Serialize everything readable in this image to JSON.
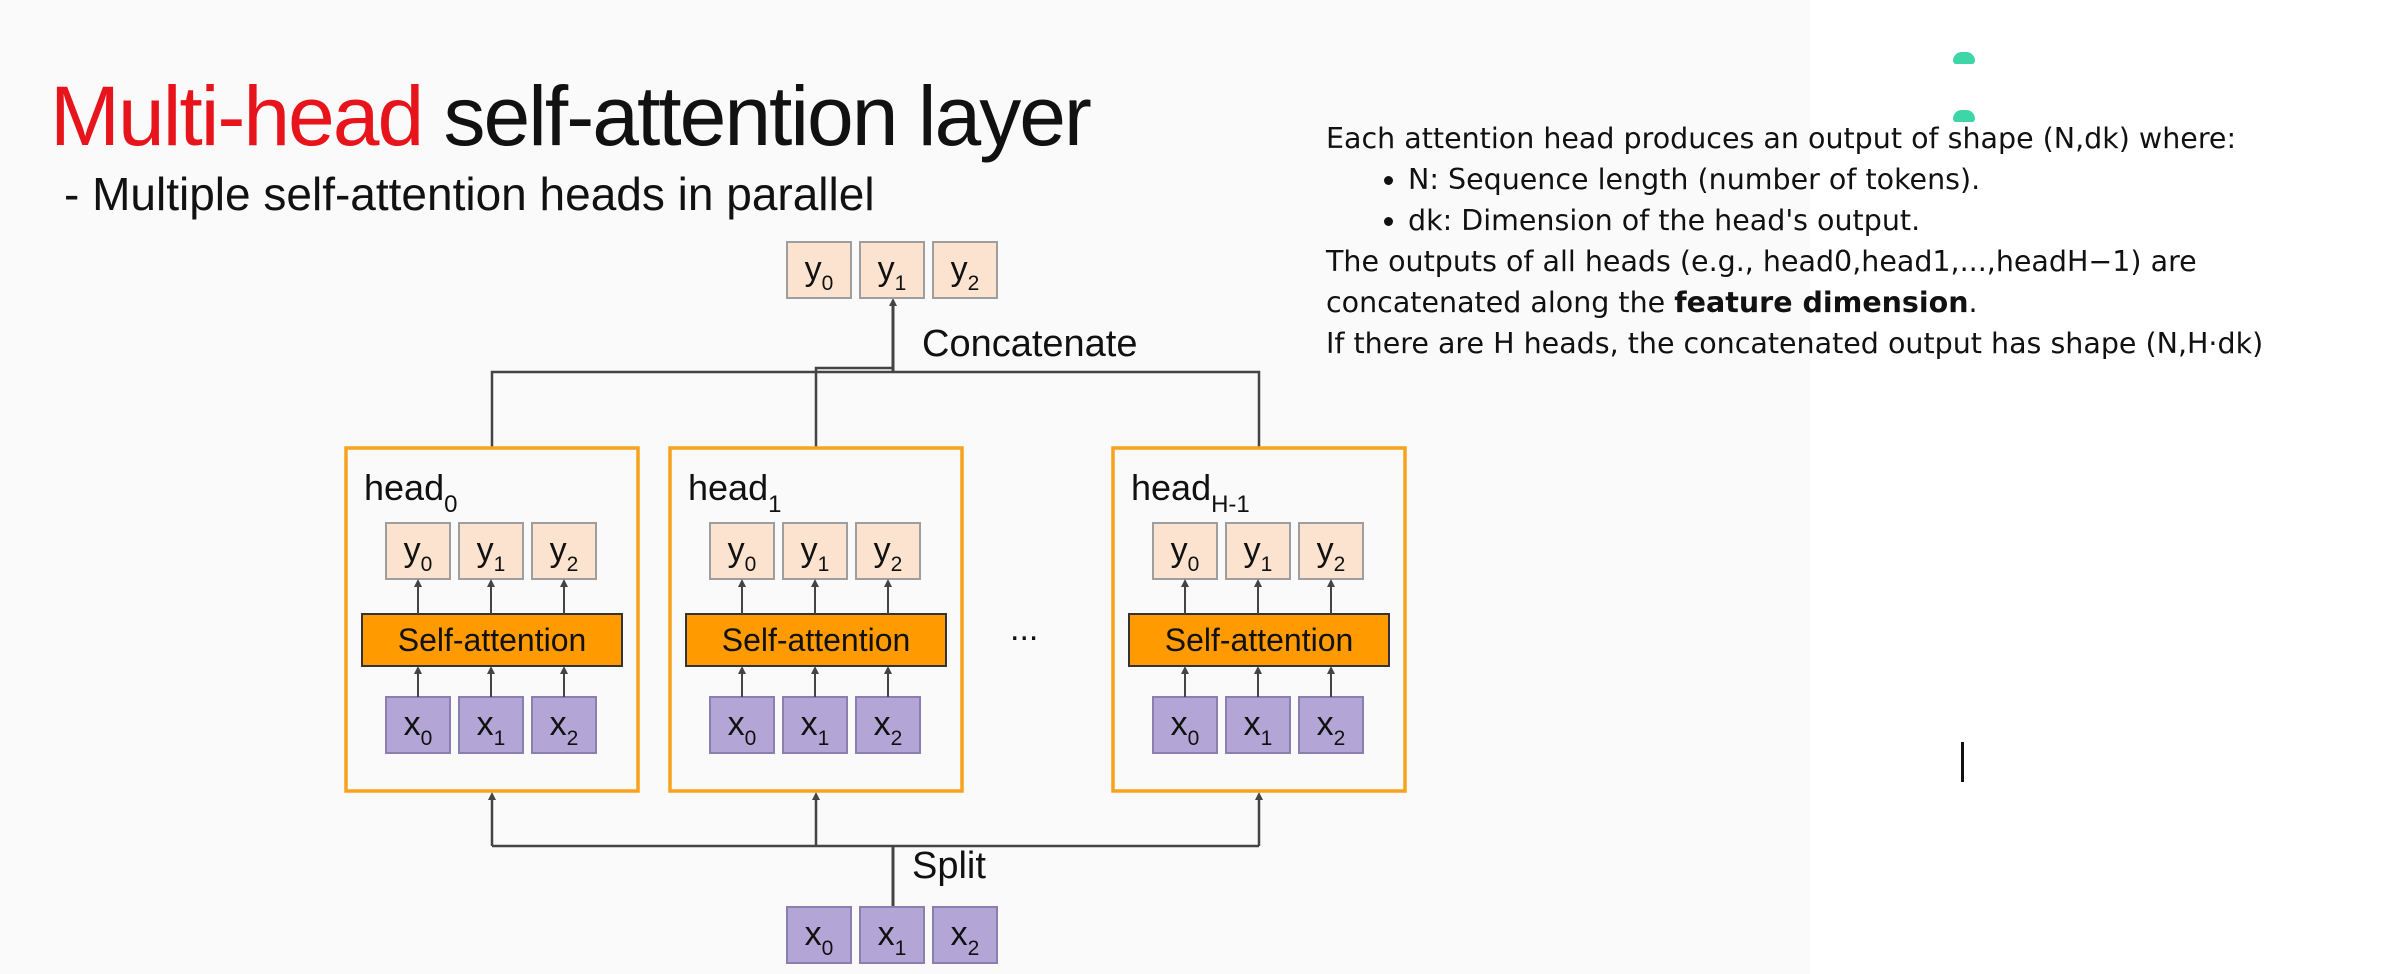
{
  "slide": {
    "title_accent": "Multi-head",
    "title_rest": " self-attention layer",
    "subtitle": "- Multiple self-attention heads in parallel"
  },
  "diagram": {
    "concat_label": "Concatenate",
    "split_label": "Split",
    "ellipsis": "...",
    "self_attention_label": "Self-attention",
    "heads": [
      {
        "name": "head",
        "sub": "0"
      },
      {
        "name": "head",
        "sub": "1"
      },
      {
        "name": "head",
        "sub": "H-1"
      }
    ],
    "outputs": [
      {
        "base": "y",
        "sub": "0"
      },
      {
        "base": "y",
        "sub": "1"
      },
      {
        "base": "y",
        "sub": "2"
      }
    ],
    "inputs": [
      {
        "base": "x",
        "sub": "0"
      },
      {
        "base": "x",
        "sub": "1"
      },
      {
        "base": "x",
        "sub": "2"
      }
    ],
    "colors": {
      "output_fill": "#fbe3cf",
      "input_fill": "#b3a6d6",
      "attention_fill": "#ff9a00",
      "head_border": "#f8a31d",
      "line": "#444444"
    }
  },
  "notes": {
    "line1": "Each attention head produces an output of shape (N,dk) where:",
    "bullets": [
      "N: Sequence length (number of tokens).",
      "dk: Dimension of the head's output."
    ],
    "line2": "The outputs of all heads (e.g., head0,head1,...,headH−1) are",
    "line3_pre": "concatenated along the ",
    "line3_bold": "feature dimension",
    "line3_post": ".",
    "line4": "If there are H heads, the concatenated output has shape (N,H·dk)"
  }
}
